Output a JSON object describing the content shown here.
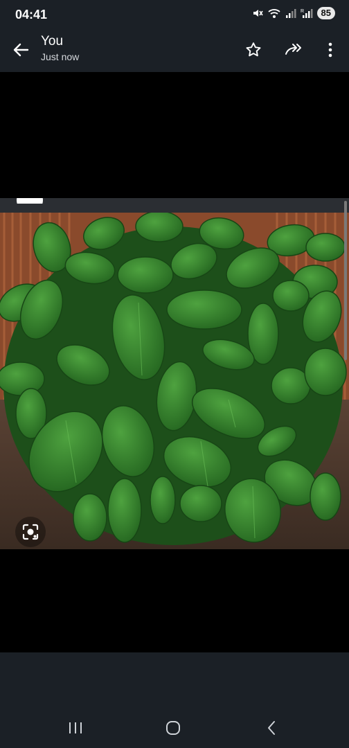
{
  "status_bar": {
    "time": "04:41",
    "battery": "85",
    "icons": [
      "mute-icon",
      "wifi-icon",
      "signal-icon",
      "signal-roaming-icon"
    ]
  },
  "app_bar": {
    "title": "You",
    "subtitle": "Just now",
    "icons": [
      "back-arrow-icon",
      "star-icon",
      "forward-icon",
      "more-vert-icon"
    ]
  },
  "image": {
    "subject": "basil plants",
    "icons": [
      "lens-search-icon"
    ]
  },
  "nav_bar": {
    "icons": [
      "recents-icon",
      "home-icon",
      "back-icon"
    ]
  },
  "colors": {
    "bar_background": "#1b2026",
    "viewer_background": "#000000",
    "leaf_green": "#2f7d2a",
    "fence_brown": "#8a4a2c"
  }
}
